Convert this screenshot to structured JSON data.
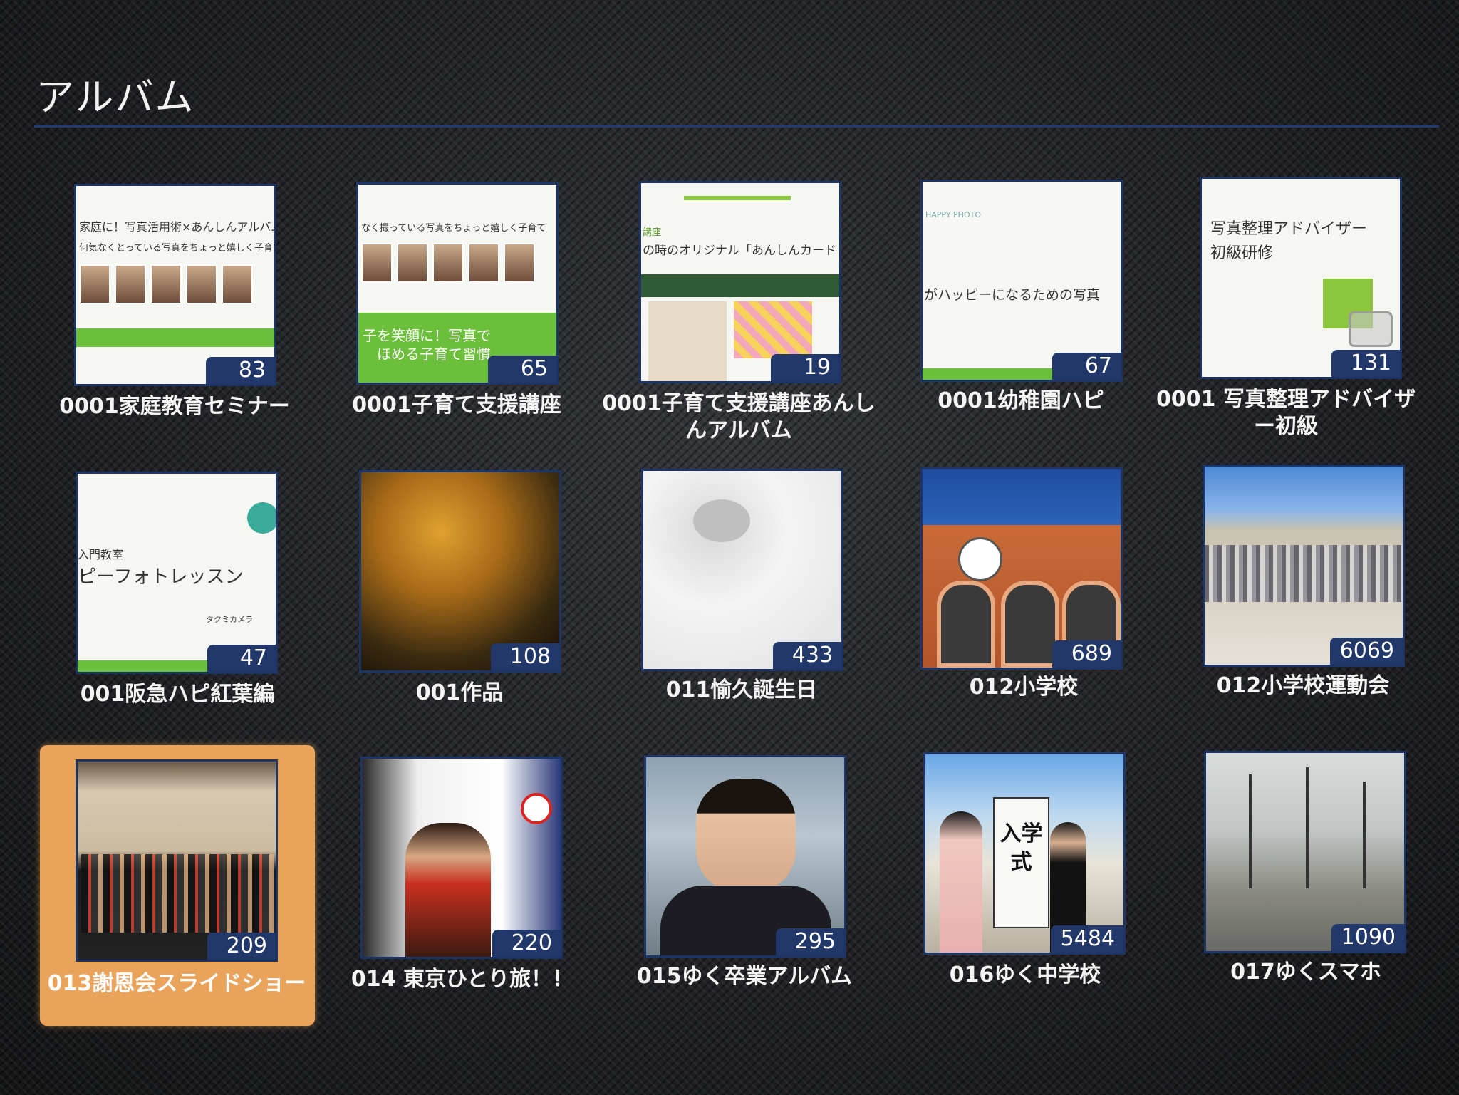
{
  "page": {
    "title": "アルバム"
  },
  "colors": {
    "accent_selected": "#e9a35a",
    "badge_bg": "#22386a",
    "rule": "#243a68"
  },
  "albums": [
    {
      "name": "0001家庭教育セミナー",
      "count": "83",
      "selected": false
    },
    {
      "name": "0001子育て支援講座",
      "count": "65",
      "selected": false
    },
    {
      "name": "0001子育て支援講座あんしんアルバム",
      "count": "19",
      "selected": false
    },
    {
      "name": "0001幼稚園ハピ",
      "count": "67",
      "selected": false
    },
    {
      "name": "0001 写真整理アドバイザー初級",
      "count": "131",
      "selected": false
    },
    {
      "name": "001阪急ハピ紅葉編",
      "count": "47",
      "selected": false
    },
    {
      "name": "001作品",
      "count": "108",
      "selected": false
    },
    {
      "name": "011愉久誕生日",
      "count": "433",
      "selected": false
    },
    {
      "name": "012小学校",
      "count": "689",
      "selected": false
    },
    {
      "name": "012小学校運動会",
      "count": "6069",
      "selected": false
    },
    {
      "name": "013謝恩会スライドショー",
      "count": "209",
      "selected": true
    },
    {
      "name": "014 東京ひとり旅！！",
      "count": "220",
      "selected": false
    },
    {
      "name": "015ゆく卒業アルバム",
      "count": "295",
      "selected": false
    },
    {
      "name": "016ゆく中学校",
      "count": "5484",
      "selected": false
    },
    {
      "name": "017ゆくスマホ",
      "count": "1090",
      "selected": false
    }
  ],
  "thumb_text": {
    "t0_line1": "家庭に！写真活用術×あんしんアルバム",
    "t0_line2": "何気なくとっている写真をちょっと嬉しく子育てに",
    "t1_line1": "なく撮っている写真をちょっと嬉しく子育て",
    "t1_line2": "子を笑顔に！写真で",
    "t1_line3": "ほめる子育て習慣",
    "t2_line1": "講座",
    "t2_line2": "の時のオリジナル「あんしんカード",
    "t3_line1": "HAPPY PHOTO",
    "t3_line2": "がハッピーになるための写真",
    "t4_line1": "写真整理アドバイザー",
    "t4_line2": "初級研修",
    "t5_line1": "入門教室",
    "t5_line2": "ピーフォトレッスン",
    "t5_line3": "タクミカメラ",
    "t13_sign": "入学式"
  }
}
